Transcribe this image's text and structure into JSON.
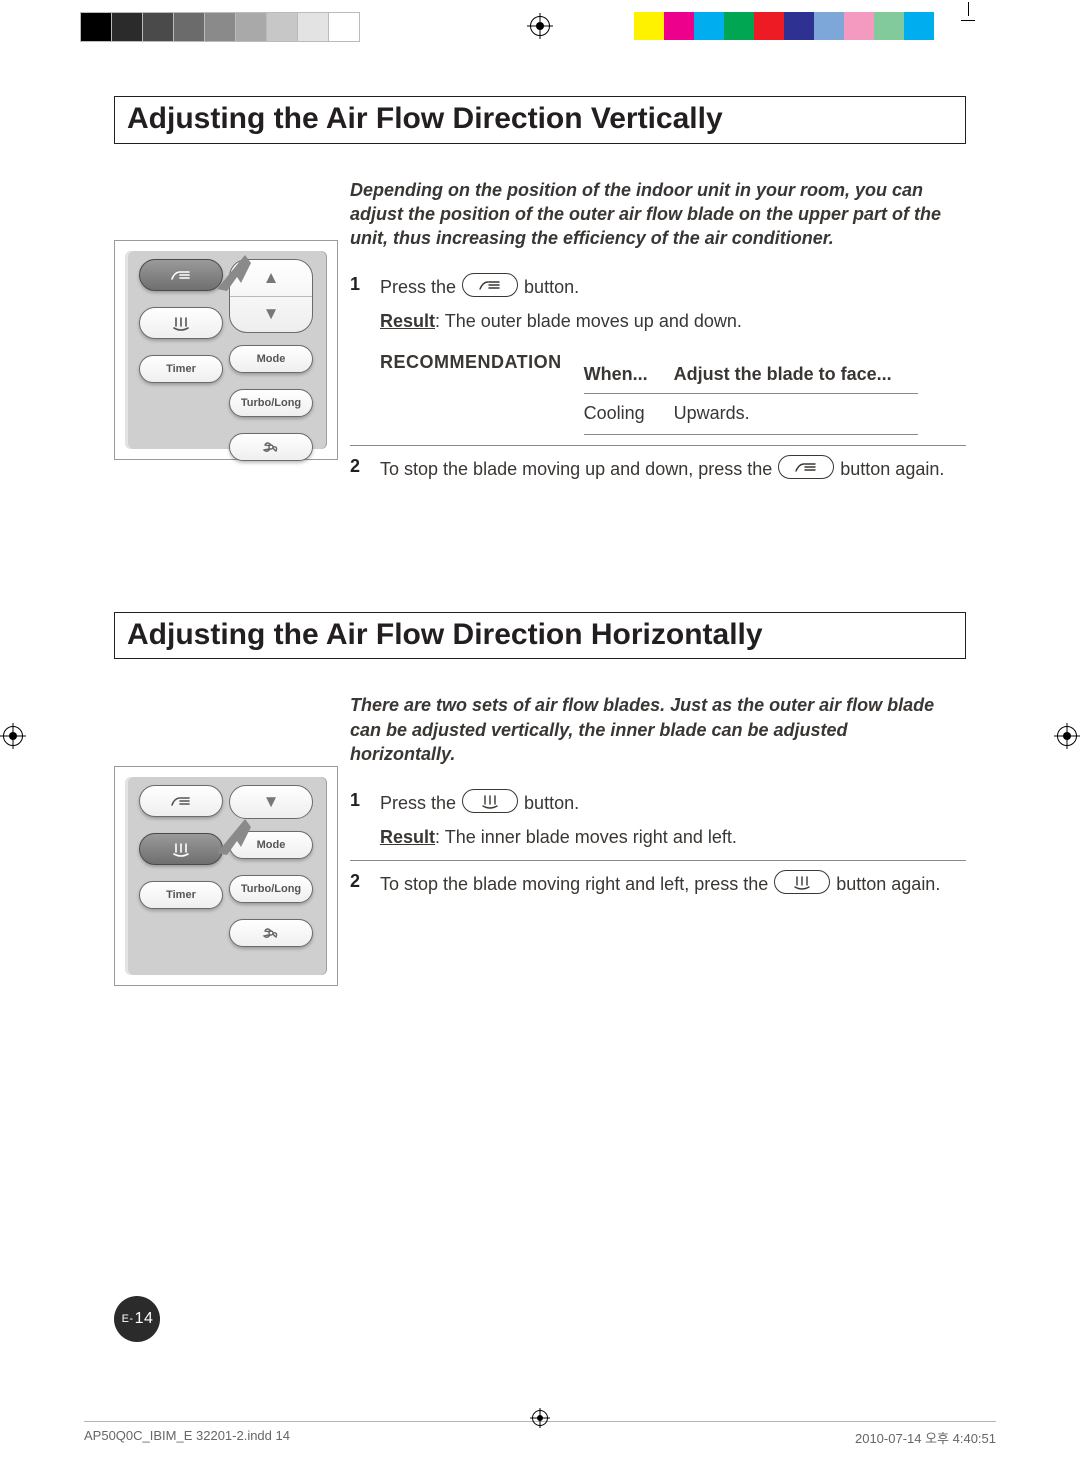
{
  "colorbar": {
    "grays": [
      "#000000",
      "#2b2b2b",
      "#4a4a4a",
      "#6b6b6b",
      "#8a8a8a",
      "#a9a9a9",
      "#c7c7c7",
      "#e3e3e3",
      "#ffffff"
    ],
    "cmyk": [
      "#fff200",
      "#ec008c",
      "#00aeef",
      "#00a651",
      "#ed1c24",
      "#2e3192",
      "#7da7d9",
      "#f49ac1",
      "#82ca9c",
      "#00adee"
    ]
  },
  "section1": {
    "title": "Adjusting the Air Flow Direction Vertically",
    "intro": "Depending on the position of the indoor unit in your room, you can adjust the position of the outer air flow blade on the upper part of the unit, thus increasing the efficiency of the air conditioner.",
    "step1_a": "Press the",
    "step1_b": "button.",
    "result_label": "Result",
    "result_text": ": The outer blade moves up and down.",
    "rec_label": "RECOMMENDATION",
    "rec_h1": "When...",
    "rec_h2": "Adjust the blade to face...",
    "rec_c1": "Cooling",
    "rec_c2": "Upwards.",
    "step2_a": "To stop the blade moving up and down, press the",
    "step2_b": "button again."
  },
  "section2": {
    "title": "Adjusting the Air Flow Direction Horizontally",
    "intro": "There are two sets of air flow blades. Just as the outer air flow blade can be adjusted vertically, the inner blade can be adjusted horizontally.",
    "step1_a": "Press the",
    "step1_b": "button.",
    "result_label": "Result",
    "result_text": ": The inner blade moves right and left.",
    "step2_a": "To stop the blade moving right and left, press the",
    "step2_b": "button again."
  },
  "remote": {
    "timer": "Timer",
    "mode": "Mode",
    "turbo": "Turbo/Long"
  },
  "footer": {
    "page_prefix": "E-",
    "page_num": "14",
    "slug_left": "AP50Q0C_IBIM_E 32201-2.indd   14",
    "slug_right": "2010-07-14   오후 4:40:51"
  }
}
